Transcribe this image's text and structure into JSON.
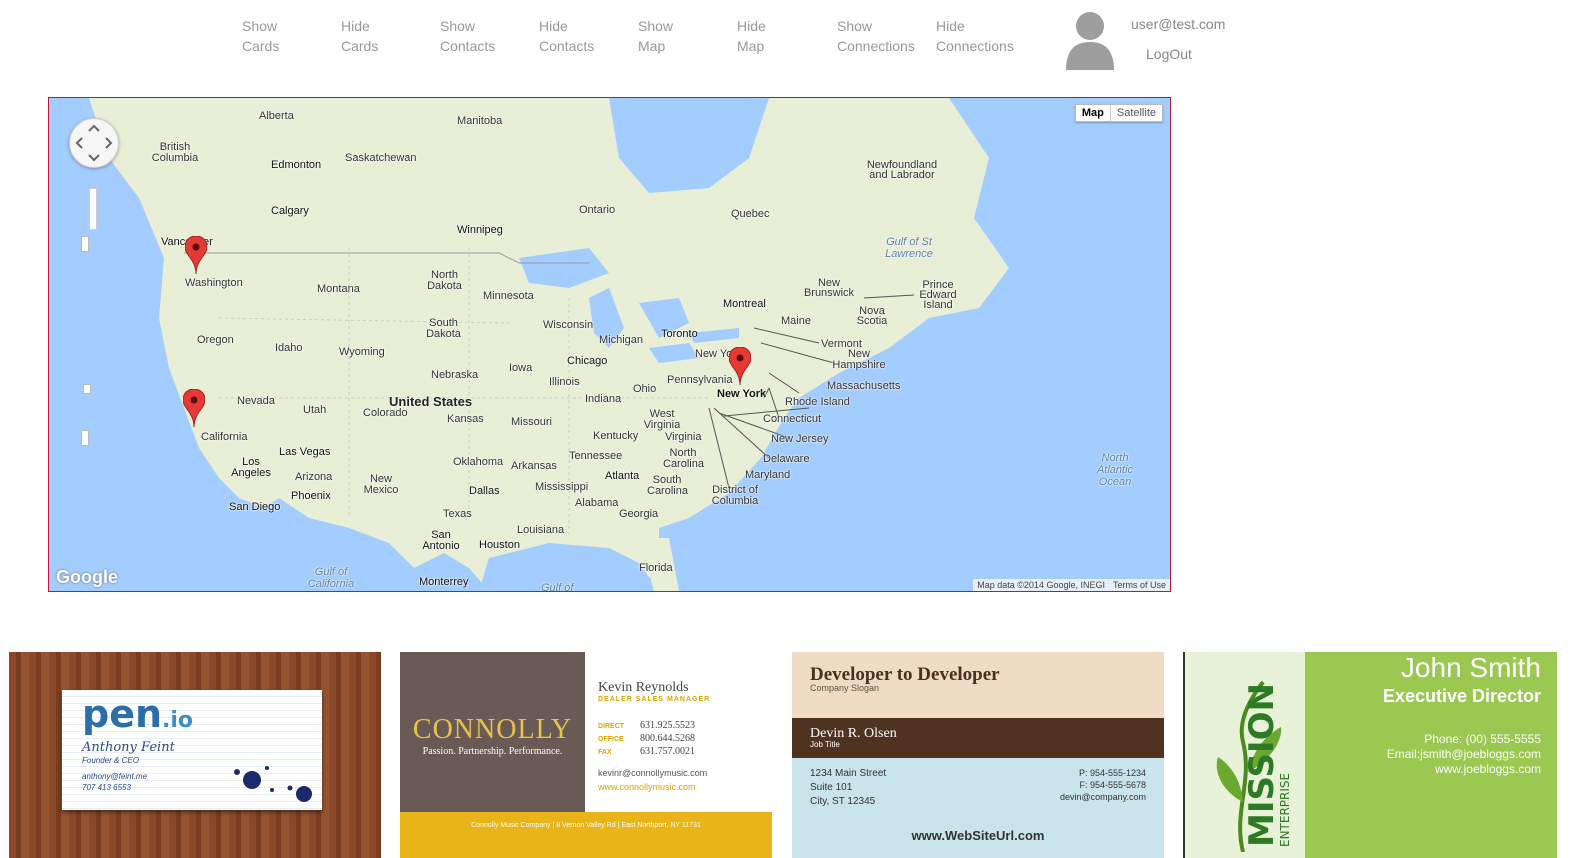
{
  "nav": {
    "show_cards": [
      "Show",
      "Cards"
    ],
    "hide_cards": [
      "Hide",
      "Cards"
    ],
    "show_contacts": [
      "Show",
      "Contacts"
    ],
    "hide_contacts": [
      "Hide",
      "Contacts"
    ],
    "show_map": [
      "Show",
      "Map"
    ],
    "hide_map": [
      "Hide",
      "Map"
    ],
    "show_connections": [
      "Show",
      "Connections"
    ],
    "hide_connections": [
      "Hide",
      "Connections"
    ]
  },
  "user": {
    "email": "user@test.com",
    "logout": "LogOut",
    "avatar_icon": "user-avatar-icon"
  },
  "map": {
    "type_map": "Map",
    "type_satellite": "Satellite",
    "logo": "Google",
    "attribution": "Map data ©2014 Google, INEGI",
    "terms": "Terms of Use",
    "labels": {
      "alberta": "Alberta",
      "manitoba": "Manitoba",
      "british_columbia": "British Columbia",
      "edmonton": "Edmonton",
      "saskatchewan": "Saskatchewan",
      "newfoundland": "Newfoundland and Labrador",
      "ontario": "Ontario",
      "quebec": "Quebec",
      "calgary": "Calgary",
      "winnipeg": "Winnipeg",
      "gulf_st_lawrence": "Gulf of St Lawrence",
      "vancouver": "Vancouver",
      "washington": "Washington",
      "north_dakota": "North Dakota",
      "montana": "Montana",
      "minnesota": "Minnesota",
      "new_brunswick": "New Brunswick",
      "prince_edward": "Prince Edward Island",
      "montreal": "Montreal",
      "maine": "Maine",
      "nova_scotia": "Nova Scotia",
      "oregon": "Oregon",
      "idaho": "Idaho",
      "south_dakota": "South Dakota",
      "wisconsin": "Wisconsin",
      "michigan": "Michigan",
      "toronto": "Toronto",
      "vermont": "Vermont",
      "new_hampshire": "New Hampshire",
      "wyoming": "Wyoming",
      "new_york_state": "New York",
      "chicago": "Chicago",
      "nebraska": "Nebraska",
      "iowa": "Iowa",
      "pennsylvania": "Pennsylvania",
      "massachusetts": "Massachusetts",
      "nevada": "Nevada",
      "utah": "Utah",
      "united_states": "United States",
      "illinois": "Illinois",
      "ohio": "Ohio",
      "new_york": "New York",
      "rhode_island": "Rhode Island",
      "colorado": "Colorado",
      "indiana": "Indiana",
      "kansas": "Kansas",
      "missouri": "Missouri",
      "west_virginia": "West Virginia",
      "connecticut": "Connecticut",
      "california": "California",
      "kentucky": "Kentucky",
      "virginia": "Virginia",
      "new_jersey": "New Jersey",
      "las_vegas": "Las Vegas",
      "tennessee": "Tennessee",
      "north_carolina": "North Carolina",
      "delaware": "Delaware",
      "los_angeles": "Los Angeles",
      "oklahoma": "Oklahoma",
      "arkansas": "Arkansas",
      "arizona": "Arizona",
      "maryland": "Maryland",
      "atlanta": "Atlanta",
      "new_mexico": "New Mexico",
      "dallas": "Dallas",
      "mississippi": "Mississippi",
      "south_carolina": "South Carolina",
      "phoenix": "Phoenix",
      "district_columbia": "District of Columbia",
      "alabama": "Alabama",
      "san_diego": "San Diego",
      "georgia": "Georgia",
      "texas": "Texas",
      "louisiana": "Louisiana",
      "san_antonio": "San Antonio",
      "houston": "Houston",
      "gulf_california": "Gulf of California",
      "florida": "Florida",
      "monterrey": "Monterrey",
      "gulf_of": "Gulf of",
      "north_atlantic": "North Atlantic Ocean"
    }
  },
  "cards": {
    "pen": {
      "logo_main": "pen",
      "logo_tld": ".io",
      "name": "Anthony Feint",
      "title": "Founder & CEO",
      "email": "anthony@feint.me",
      "phone": "707 413 6553"
    },
    "connolly": {
      "brand": "CONNOLLY",
      "tagline": "Passion. Partnership. Performance.",
      "name": "Kevin Reynolds",
      "title": "DEALER SALES MANAGER",
      "direct_label": "DIRECT",
      "direct": "631.925.5523",
      "office_label": "OFFICE",
      "office": "800.644.5268",
      "fax_label": "FAX",
      "fax": "631.757.0021",
      "email": "kevinr@connollymusic.com",
      "url": "www.connollymusic.com",
      "footer": "Connolly Music Company  |  8 Vernon Valley Rd  |  East Northport, NY 11731"
    },
    "dev": {
      "heading": "Developer to Developer",
      "slogan": "Company Slogan",
      "name": "Devin R. Olsen",
      "job": "Job Title",
      "addr1": "1234 Main Street",
      "addr2": "Suite 101",
      "addr3": "City, ST 12345",
      "phone": "P: 954-555-1234",
      "fax": "F: 954-555-5678",
      "email": "devin@company.com",
      "web": "www.WebSiteUrl.com"
    },
    "mission": {
      "logo": "MISSION",
      "logo_sub": "ENTERPRISE",
      "name": "John Smith",
      "title": "Executive Director",
      "phone": "Phone: (00) 555-5555",
      "email": "Email:jsmith@joebloggs.com",
      "web": "www.joebloggs.com"
    }
  },
  "colors": {
    "map_border": "#c0143c",
    "marker": "#e53935",
    "water": "#a3ccff",
    "land": "#e8efd6"
  }
}
